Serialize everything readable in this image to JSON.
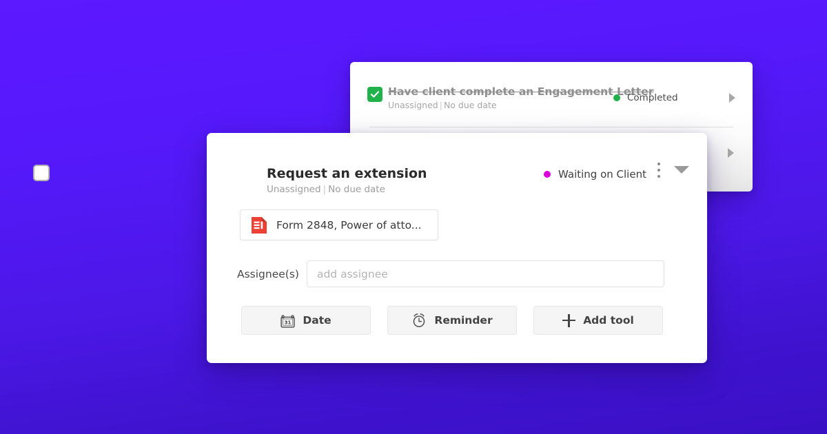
{
  "theme": {
    "background_gradient_from": "#5C18FF",
    "background_gradient_to": "#3A10C4",
    "status_completed_color": "#1FB24A",
    "status_waiting_color": "#D900D9",
    "document_icon_color": "#EE4136"
  },
  "back_card": {
    "rows": [
      {
        "checkbox_state": "checked",
        "title": "Have client complete an Engagement Letter",
        "assignee": "Unassigned",
        "separator": "|",
        "due_date": "No due date",
        "status_label": "Completed",
        "status_dot_color": "#1FB24A",
        "expand_icon": "caret-right-icon"
      },
      {
        "expand_icon": "caret-right-icon"
      }
    ]
  },
  "front_card": {
    "checkbox_state": "unchecked",
    "title": "Request an extension",
    "assignee": "Unassigned",
    "separator": "|",
    "due_date": "No due date",
    "status_label": "Waiting on Client",
    "status_dot_color": "#D900D9",
    "kebab_icon": "more-vertical-icon",
    "collapse_icon": "caret-down-icon",
    "tool_chip": {
      "icon": "document-form-icon",
      "label": "Form 2848, Power of atto..."
    },
    "assignee_field": {
      "label": "Assignee(s)",
      "placeholder": "add assignee",
      "value": ""
    },
    "actions": [
      {
        "id": "date",
        "label": "Date",
        "icon": "calendar-31-icon"
      },
      {
        "id": "reminder",
        "label": "Reminder",
        "icon": "alarm-clock-icon"
      },
      {
        "id": "add-tool",
        "label": "Add tool",
        "icon": "plus-icon"
      }
    ]
  }
}
